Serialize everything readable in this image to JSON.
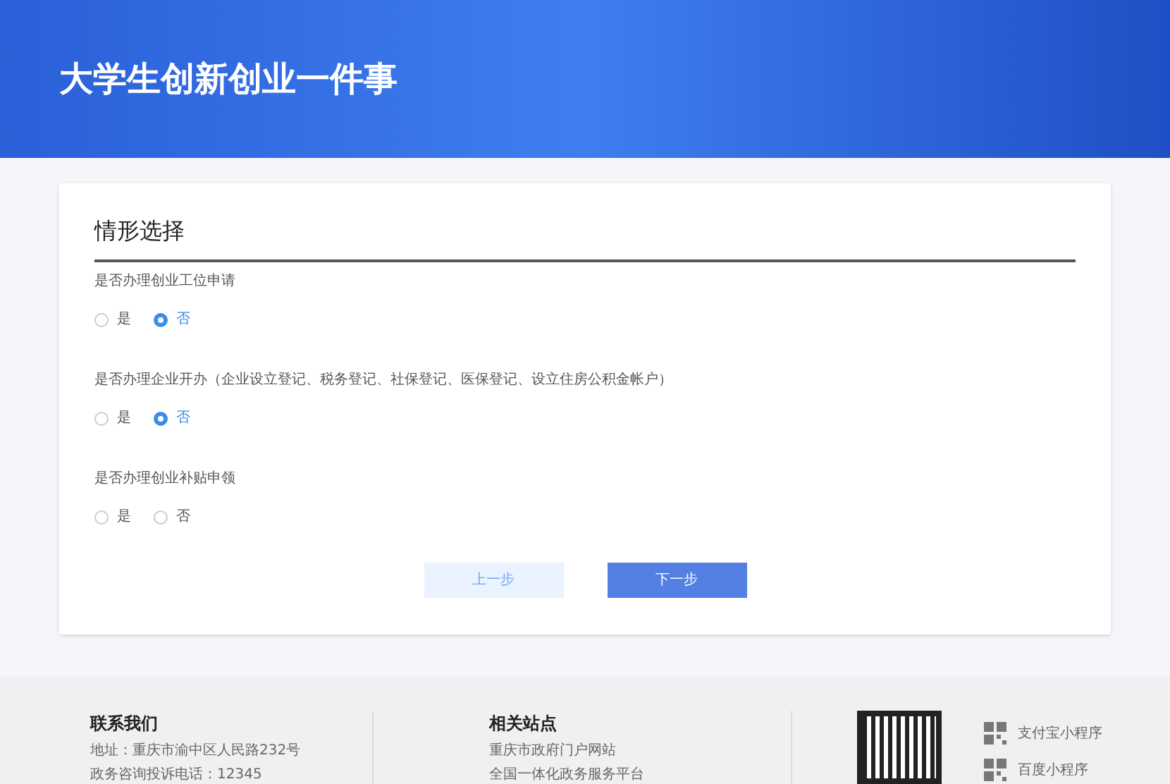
{
  "banner": {
    "title": "大学生创新创业一件事"
  },
  "card": {
    "title": "情形选择",
    "questions": [
      {
        "label": "是否办理创业工位申请",
        "options": [
          {
            "label": "是",
            "selected": false
          },
          {
            "label": "否",
            "selected": true
          }
        ]
      },
      {
        "label": "是否办理企业开办（企业设立登记、税务登记、社保登记、医保登记、设立住房公积金帐户）",
        "options": [
          {
            "label": "是",
            "selected": false
          },
          {
            "label": "否",
            "selected": true
          }
        ]
      },
      {
        "label": "是否办理创业补贴申领",
        "options": [
          {
            "label": "是",
            "selected": false
          },
          {
            "label": "否",
            "selected": false
          }
        ]
      }
    ],
    "buttons": [
      {
        "label": "上一步",
        "kind": "secondary"
      },
      {
        "label": "下一步",
        "kind": "primary"
      }
    ]
  },
  "footer": {
    "contact": {
      "title": "联系我们",
      "lines": [
        "地址：重庆市渝中区人民路232号",
        "政务咨询投诉电话：12345"
      ]
    },
    "sites": {
      "title": "相关站点",
      "links": [
        "重庆市政府门户网站",
        "全国一体化政务服务平台"
      ]
    },
    "mini_programs": [
      "支付宝小程序",
      "百度小程序"
    ]
  }
}
